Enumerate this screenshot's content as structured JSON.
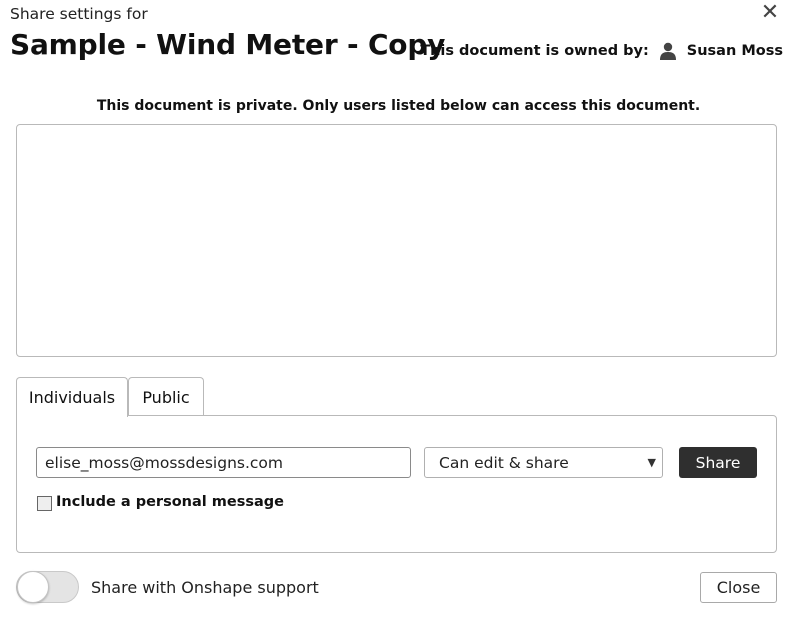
{
  "dialog": {
    "subtitle": "Share settings for",
    "document_title": "Sample - Wind Meter - Copy",
    "close_icon": "close-icon",
    "owner_label": "This document is owned by:",
    "owner_name": "Susan Moss",
    "owner_icon": "user-icon",
    "private_note": "This document is private. Only users listed below can access this document."
  },
  "tabs": [
    {
      "label": "Individuals",
      "active": true
    },
    {
      "label": "Public",
      "active": false
    }
  ],
  "share_form": {
    "email_value": "elise_moss@mossdesigns.com",
    "permission_selected": "Can edit & share",
    "share_button": "Share",
    "personal_message_label": "Include a personal message",
    "personal_message_checked": false
  },
  "footer": {
    "support_toggle_label": "Share with Onshape support",
    "support_toggle_on": false,
    "close_button": "Close"
  },
  "colors": {
    "share_button_bg": "#2f2f2f",
    "border": "#b9b9b9"
  }
}
